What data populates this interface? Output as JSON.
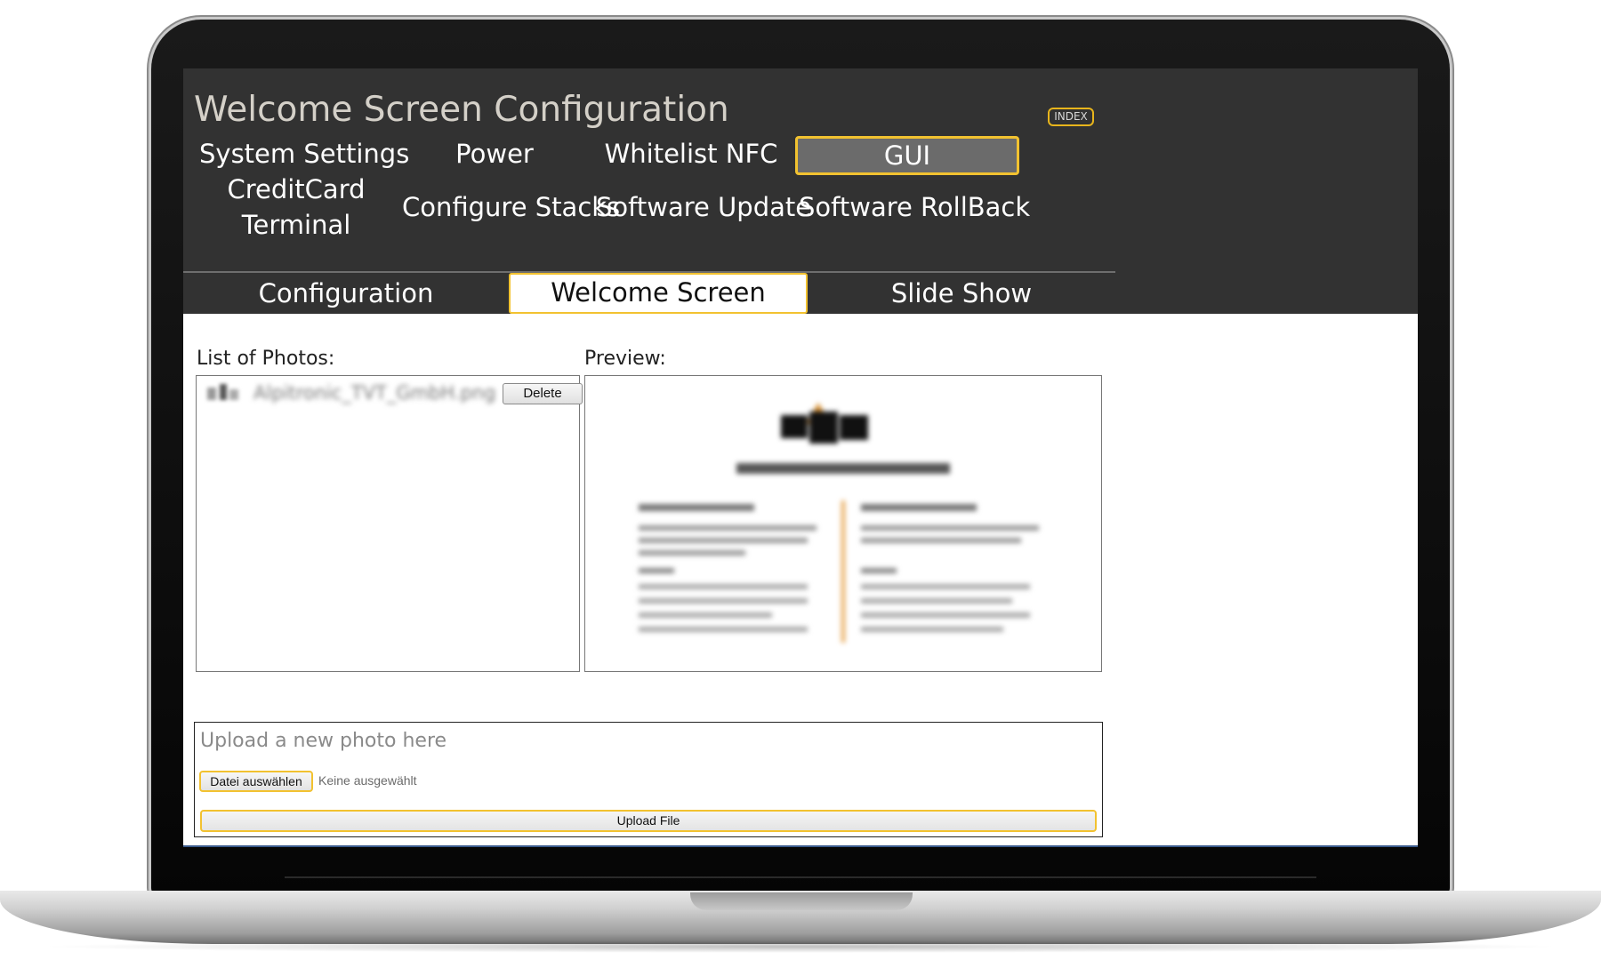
{
  "page_title": "Welcome Screen Configuration",
  "index_label": "INDEX",
  "nav": {
    "system_settings": "System Settings",
    "power": "Power",
    "whitelist_nfc": "Whitelist NFC",
    "gui": "GUI",
    "creditcard_terminal": "CreditCard Terminal",
    "configure_stacks": "Configure Stacks",
    "software_update": "Software Update",
    "software_rollback": "Software RollBack",
    "active": "GUI"
  },
  "subtabs": {
    "configuration": "Configuration",
    "welcome_screen": "Welcome Screen",
    "slide_show": "Slide Show",
    "active": "Welcome Screen"
  },
  "photos": {
    "list_label": "List of Photos:",
    "items": [
      {
        "name": "Alpitronic_TVT_GmbH.png",
        "delete_label": "Delete"
      }
    ]
  },
  "preview": {
    "label": "Preview:"
  },
  "upload": {
    "title": "Upload a new photo here",
    "choose_file_label": "Datei auswählen",
    "file_status": "Keine ausgewählt",
    "submit_label": "Upload File"
  },
  "colors": {
    "header_bg": "#323232",
    "accent": "#f2c230",
    "active_nav_bg": "#6b6b6b"
  }
}
